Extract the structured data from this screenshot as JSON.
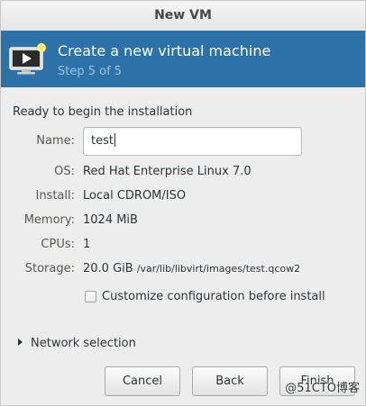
{
  "window": {
    "title": "New VM"
  },
  "banner": {
    "title": "Create a new virtual machine",
    "subtitle": "Step 5 of 5",
    "icon": "vm-monitor-icon"
  },
  "summary": {
    "heading": "Ready to begin the installation",
    "name_label": "Name:",
    "name_value": "test",
    "rows": [
      {
        "label": "OS:",
        "value": "Red Hat Enterprise Linux 7.0"
      },
      {
        "label": "Install:",
        "value": "Local CDROM/ISO"
      },
      {
        "label": "Memory:",
        "value": "1024 MiB"
      },
      {
        "label": "CPUs:",
        "value": "1"
      }
    ],
    "storage_label": "Storage:",
    "storage_size": "20.0 GiB",
    "storage_path": "/var/lib/libvirt/images/test.qcow2",
    "customize_label": "Customize configuration before install",
    "customize_checked": false
  },
  "network": {
    "label": "Network selection",
    "expanded": false
  },
  "buttons": {
    "cancel": "Cancel",
    "back": "Back",
    "finish": "Finish"
  },
  "watermark": "@51CTO博客",
  "colors": {
    "banner_bg": "#2c72a8",
    "banner_subtitle": "#9cc3e3"
  }
}
